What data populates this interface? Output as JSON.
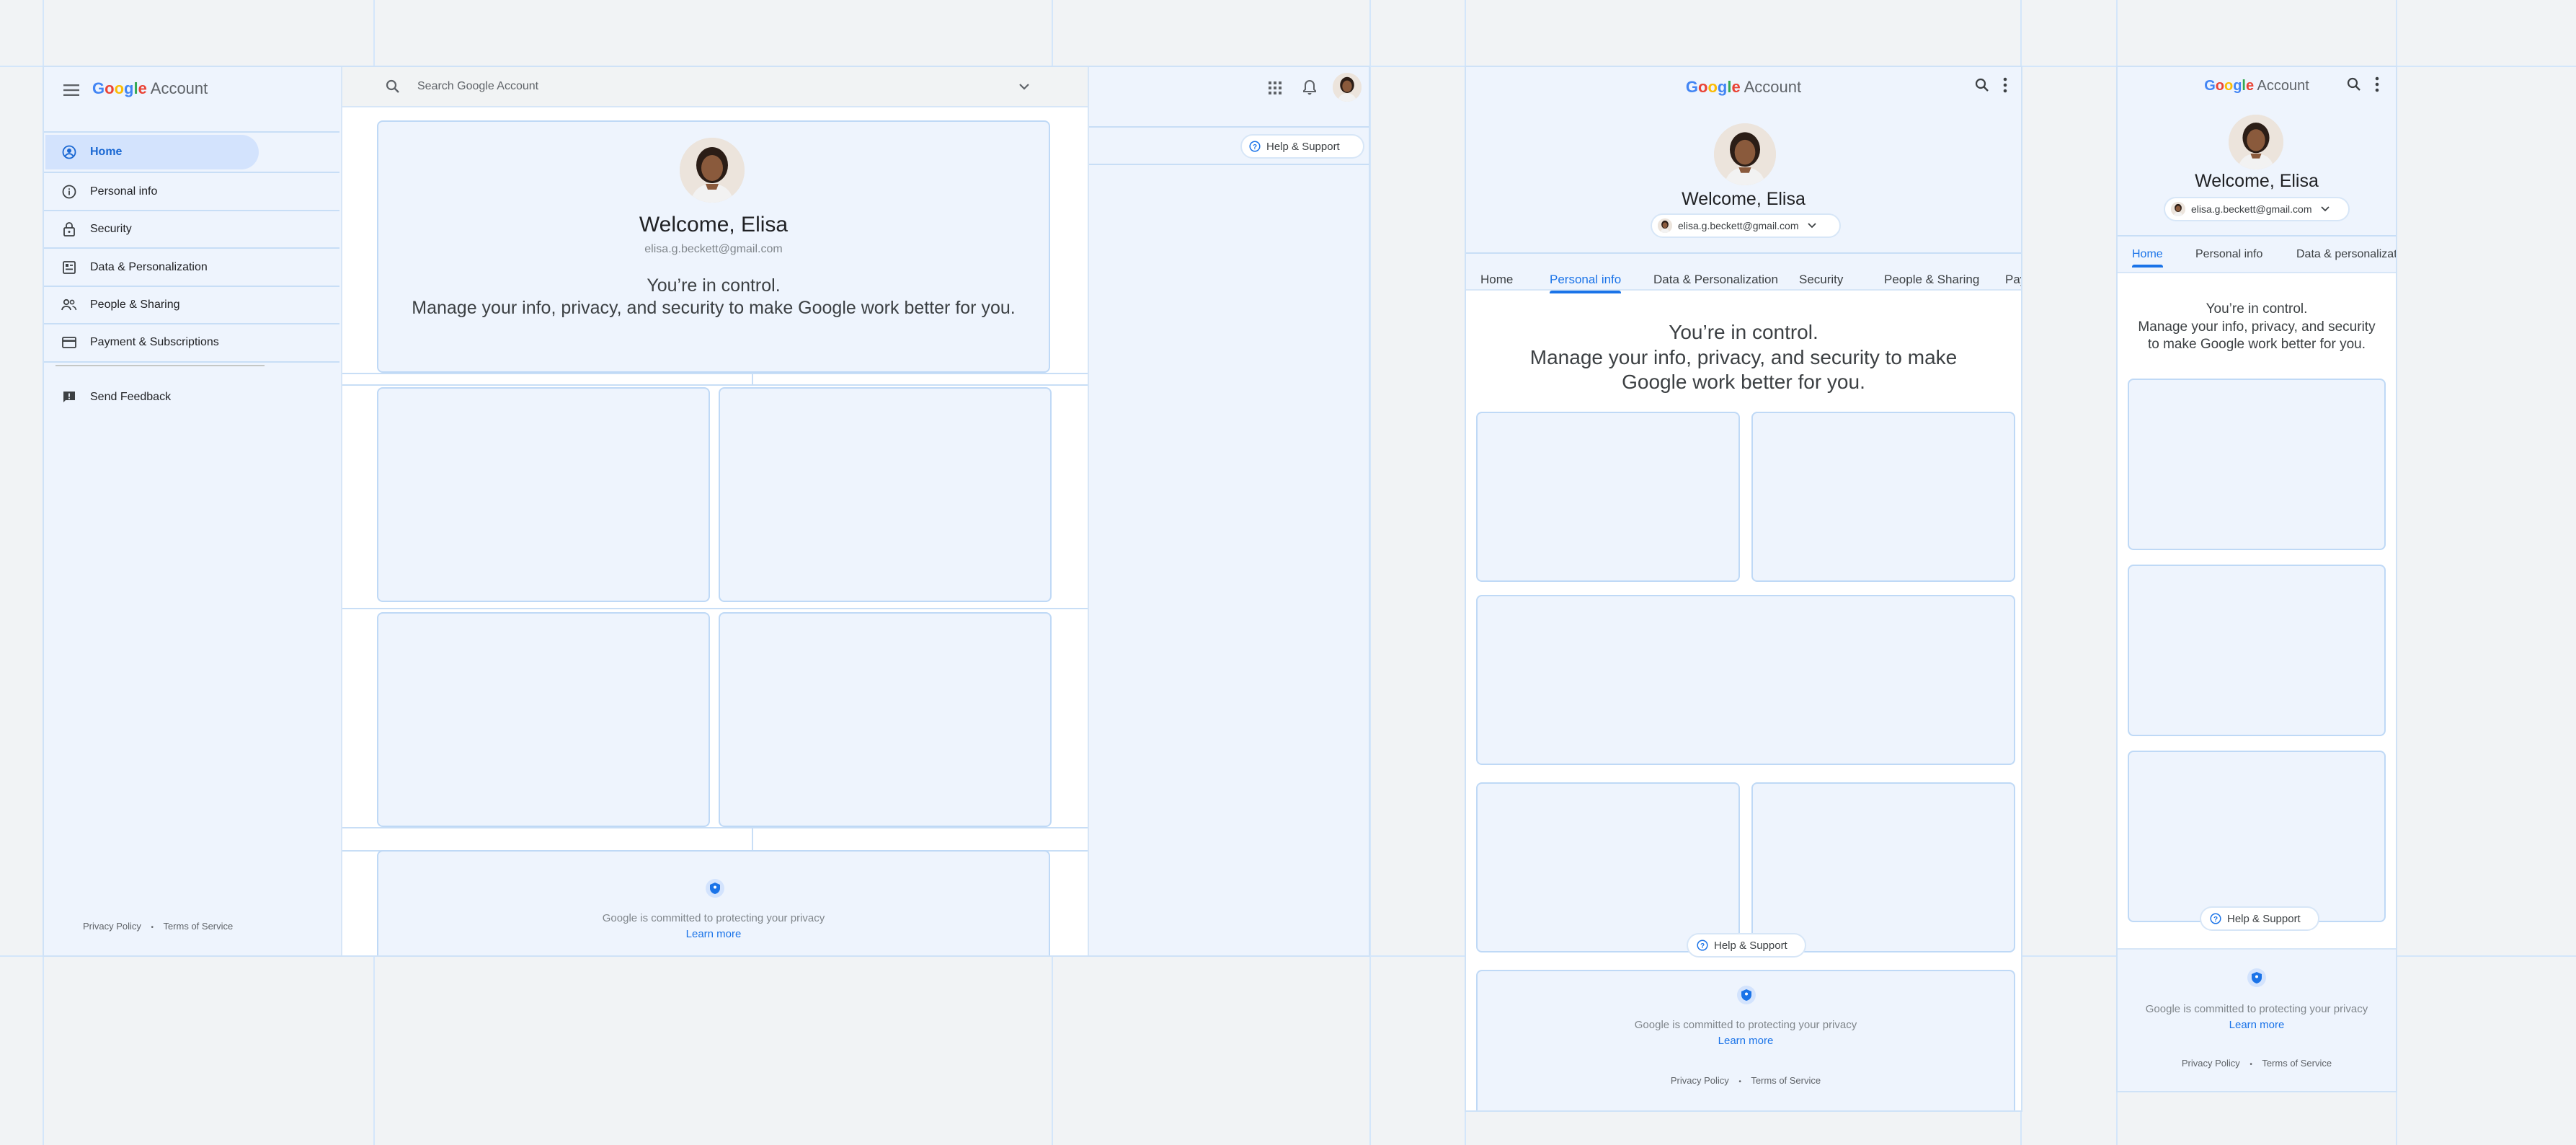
{
  "brand": {
    "logo_letters": [
      "G",
      "o",
      "o",
      "g",
      "l",
      "e"
    ],
    "logo_colors": [
      "#4285F4",
      "#EA4335",
      "#FBBC05",
      "#4285F4",
      "#34A853",
      "#EA4335"
    ],
    "account_label": "Account"
  },
  "user": {
    "welcome": "Welcome, Elisa",
    "email": "elisa.g.beckett@gmail.com"
  },
  "hero": {
    "line1": "You’re in control.",
    "line2": "Manage your info, privacy, and security to make Google work better for you."
  },
  "desktop": {
    "search_placeholder": "Search Google Account",
    "help_label": "Help & Support",
    "sidebar": {
      "items": [
        {
          "label": "Home",
          "icon": "account-circle-icon",
          "active": true
        },
        {
          "label": "Personal info",
          "icon": "info-icon"
        },
        {
          "label": "Security",
          "icon": "lock-icon"
        },
        {
          "label": "Data & Personalization",
          "icon": "data-icon"
        },
        {
          "label": "People & Sharing",
          "icon": "people-icon"
        },
        {
          "label": "Payment & Subscriptions",
          "icon": "credit-card-icon"
        }
      ],
      "feedback_label": "Send Feedback",
      "footer_privacy": "Privacy Policy",
      "footer_separator": "•",
      "footer_terms": "Terms of Service"
    },
    "footer_privacy_text": "Google is committed to protecting your privacy",
    "footer_learn_more": "Learn more"
  },
  "tablet": {
    "tabs": [
      "Home",
      "Personal info",
      "Data & Personalization",
      "Security",
      "People & Sharing",
      "Pay"
    ],
    "active_tab": 1,
    "help_label": "Help & Support",
    "privacy_text": "Google is committed to protecting your privacy",
    "learn_more": "Learn more",
    "footer_privacy": "Privacy Policy",
    "footer_separator": "•",
    "footer_terms": "Terms of Service"
  },
  "mobile": {
    "tabs": [
      "Home",
      "Personal info",
      "Data & personalization"
    ],
    "active_tab": 0,
    "hero_line1": "You’re in control.",
    "hero_line2": "Manage your info, privacy, and security to make Google work better for you.",
    "help_label": "Help & Support",
    "privacy_text": "Google is committed to protecting your privacy",
    "learn_more": "Learn more",
    "footer_privacy": "Privacy Policy",
    "footer_separator": "•",
    "footer_terms": "Terms of Service"
  },
  "colors": {
    "accent": "#1a73e8",
    "surface": "#eef4fd",
    "card_border": "#bfd9f6",
    "background": "#f1f3f5"
  }
}
